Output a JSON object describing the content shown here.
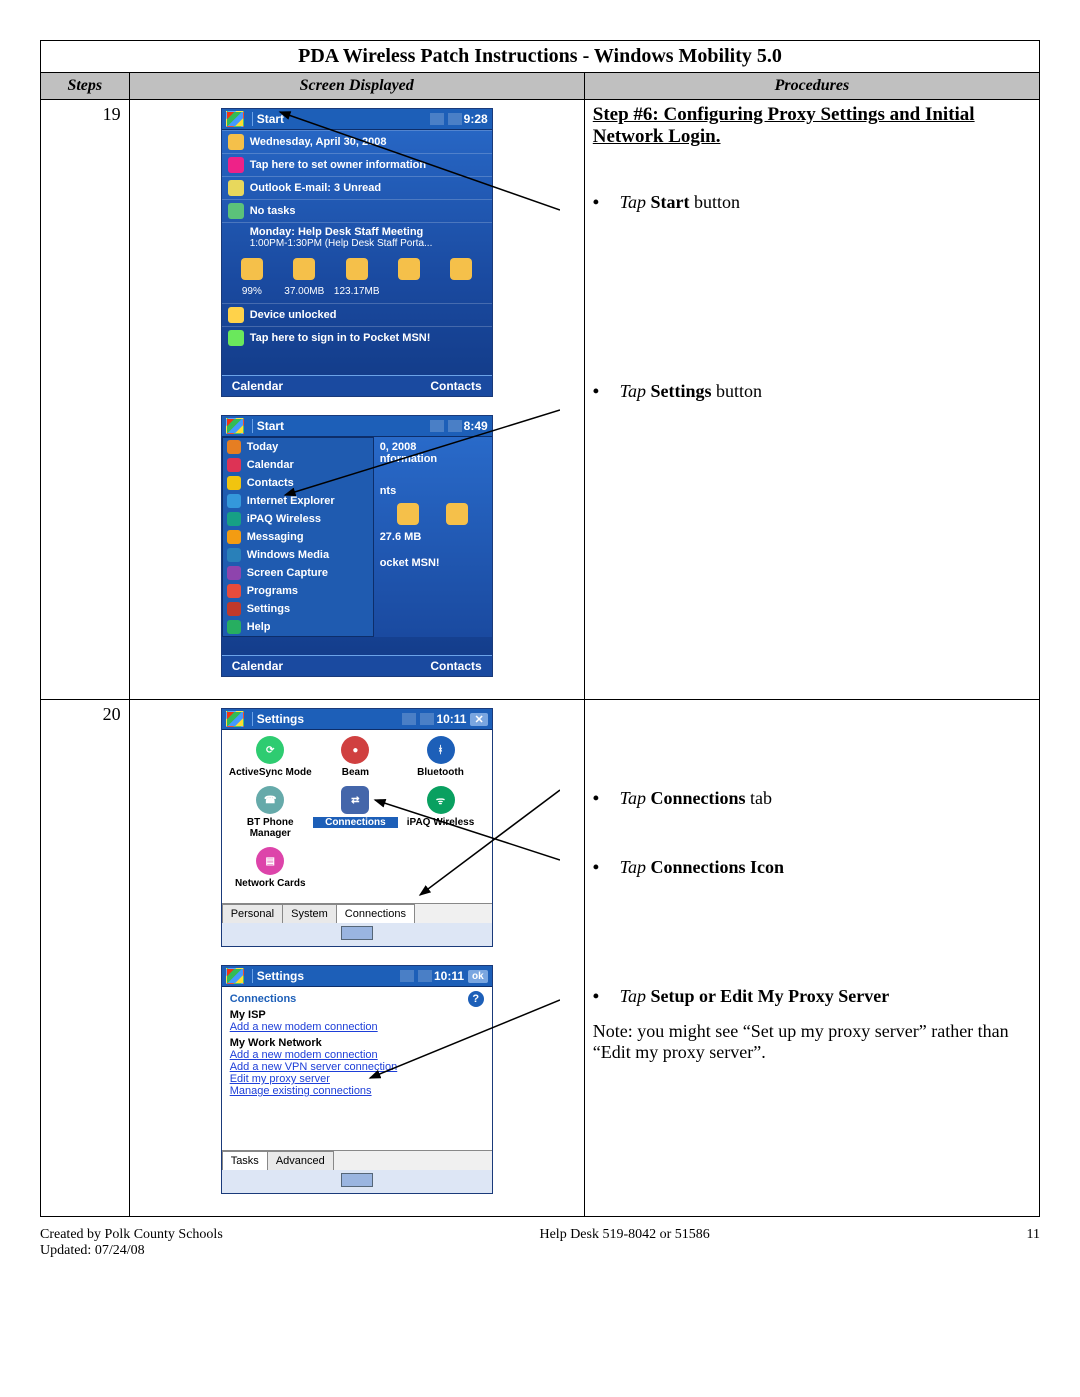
{
  "doc": {
    "title": "PDA Wireless Patch Instructions - Windows Mobility 5.0",
    "col_steps": "Steps",
    "col_screen": "Screen Displayed",
    "col_proc": "Procedures"
  },
  "step19": {
    "num": "19",
    "heading": "Step #6: Configuring Proxy Settings and Initial Network Login.",
    "instr1_tap": "Tap ",
    "instr1_bold": "Start",
    "instr1_after": " button",
    "instr2_tap": "Tap ",
    "instr2_bold": "Settings",
    "instr2_after": " button",
    "home": {
      "topbar": "Start",
      "time": "9:28",
      "date": "Wednesday, April 30, 2008",
      "owner": "Tap here to set owner information",
      "outlook": "Outlook E-mail: 3 Unread",
      "notasks": "No tasks",
      "appt1": "Monday: Help Desk Staff Meeting",
      "appt1b": "1:00PM-1:30PM (Help Desk Staff Porta...",
      "m1": "99%",
      "m2": "37.00MB",
      "m3": "123.17MB",
      "unlocked": "Device unlocked",
      "msn": "Tap here to sign in to Pocket MSN!",
      "sk_left": "Calendar",
      "sk_right": "Contacts"
    },
    "menu": {
      "topbar": "Start",
      "time": "8:49",
      "items": [
        "Today",
        "Calendar",
        "Contacts",
        "Internet Explorer",
        "iPAQ Wireless",
        "Messaging",
        "Windows Media",
        "Screen Capture",
        "Programs",
        "Settings",
        "Help"
      ],
      "right_date": "0, 2008",
      "right_info": "nformation",
      "right_nts": "nts",
      "right_mb": "27.6 MB",
      "right_msn": "ocket MSN!",
      "sk_left": "Calendar",
      "sk_right": "Contacts"
    }
  },
  "step20": {
    "num": "20",
    "instr1_tap": "Tap ",
    "instr1_bold": "Connections",
    "instr1_after": "  tab",
    "instr2_tap": "Tap  ",
    "instr2_bold": "Connections Icon",
    "instr3_tap": "Tap ",
    "instr3_bold": "Setup or Edit My Proxy Server",
    "note": "Note: you might see “Set up my proxy server” rather than “Edit my proxy server”.",
    "settings": {
      "topbar": "Settings",
      "time": "10:11",
      "items": [
        "ActiveSync Mode",
        "Beam",
        "Bluetooth",
        "BT Phone Manager",
        "Connections",
        "iPAQ Wireless",
        "Network Cards"
      ],
      "tabs": [
        "Personal",
        "System",
        "Connections"
      ]
    },
    "conn": {
      "topbar": "Settings",
      "time": "10:11",
      "ok": "ok",
      "title": "Connections",
      "isp": "My ISP",
      "isp_link": "Add a new modem connection",
      "work": "My Work Network",
      "work_l1": "Add a new modem connection",
      "work_l2": "Add a new VPN server connection",
      "work_l3": "Edit my proxy server",
      "work_l4": "Manage existing connections",
      "tabs": [
        "Tasks",
        "Advanced"
      ]
    }
  },
  "footer": {
    "left1": "Created by Polk County Schools",
    "left2": "Updated: 07/24/08",
    "center": "Help Desk 519-8042 or 51586",
    "right": "11"
  }
}
